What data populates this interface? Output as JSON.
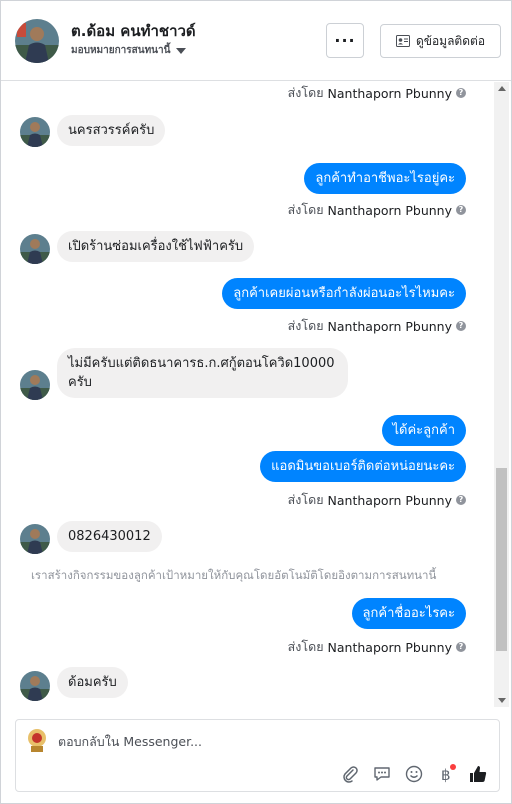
{
  "header": {
    "contact_name": "ต.ด้อม คนทำชาวด์",
    "status_label": "มอบหมายการสนทนานี้",
    "more_label": "···",
    "contact_info_label": "ดูข้อมูลติดต่อ"
  },
  "messages": {
    "sent_by_prefix": "ส่งโดย",
    "sender_name": "Nanthaporn Pbunny",
    "in_1": "นครสวรรค์ครับ",
    "out_1": "ลูกค้าทำอาชีพอะไรอยู่คะ",
    "in_2": "เปิดร้านซ่อมเครื่องใช้ไฟฟ้าครับ",
    "out_2": "ลูกค้าเคยผ่อนหรือกำลังผ่อนอะไรไหมคะ",
    "in_3_line1": "ไม่มีครับแต่ติดธนาคารธ.ก.ศกู้ตอนโควิด10000",
    "in_3_line2": "ครับ",
    "out_3a": "ได้ค่ะลูกค้า",
    "out_3b": "แอดมินขอเบอร์ติดต่อหน่อยนะคะ",
    "in_4": "0826430012",
    "system_note": "เราสร้างกิจกรรมของลูกค้าเป้าหมายให้กับคุณโดยอัตโนมัติโดยอิงตามการสนทนานี้",
    "out_4": "ลูกค้าชื่ออะไรคะ",
    "in_5": "ด้อมครับ"
  },
  "composer": {
    "placeholder": "ตอบกลับใน Messenger...",
    "icons": [
      "paperclip-icon",
      "quick-reply-icon",
      "emoji-icon",
      "payment-icon",
      "like-icon"
    ]
  },
  "colors": {
    "outgoing_bubble": "#0084ff",
    "incoming_bubble": "#f1f0f0",
    "like_icon": "#1c1e21"
  }
}
